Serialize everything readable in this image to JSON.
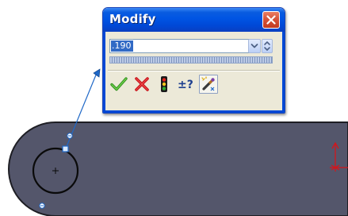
{
  "dialog": {
    "title": "Modify",
    "value": ".190"
  },
  "toolbar": {
    "buttons": [
      {
        "name": "ok",
        "icon": "green-check-icon"
      },
      {
        "name": "cancel",
        "icon": "red-x-icon"
      },
      {
        "name": "rebuild",
        "icon": "traffic-light-icon"
      },
      {
        "name": "reverse-sense",
        "icon": "plus-minus-question-icon"
      },
      {
        "name": "mark-dimension",
        "icon": "mark-dimension-icon"
      }
    ]
  },
  "colors": {
    "part_fill": "#54566b",
    "dimension_line": "#1f68c7",
    "origin": "#d4151b",
    "title_bar": "#0054e3",
    "close_button": "#d6533a",
    "selection": "#316ac5"
  }
}
